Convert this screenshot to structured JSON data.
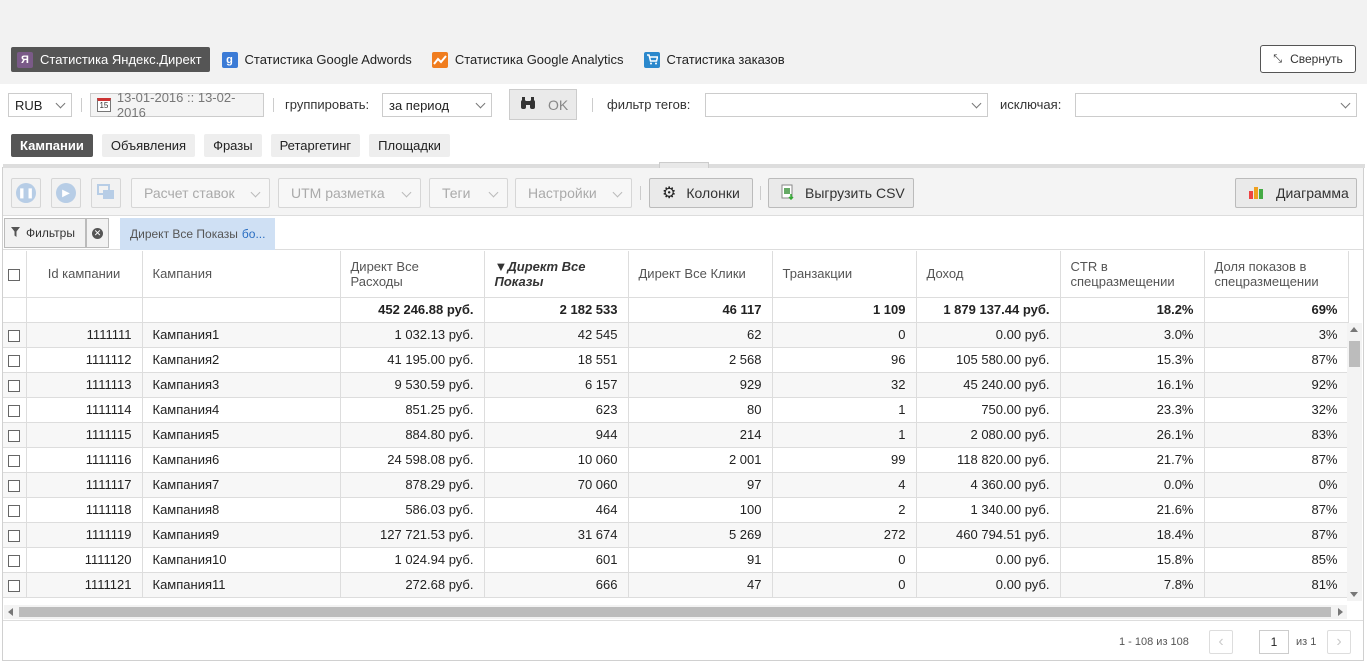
{
  "sources": [
    {
      "label": "Статистика Яндекс.Директ",
      "icon": "yandex-icon",
      "active": true
    },
    {
      "label": "Статистика Google Adwords",
      "icon": "google-adwords-icon",
      "active": false
    },
    {
      "label": "Статистика Google Analytics",
      "icon": "google-analytics-icon",
      "active": false
    },
    {
      "label": "Статистика заказов",
      "icon": "cart-icon",
      "active": false
    }
  ],
  "collapse_label": "Свернуть",
  "filters": {
    "currency": "RUB",
    "date_range": "13-01-2016 :: 13-02-2016",
    "group_label": "группировать:",
    "group_value": "за период",
    "ok_label": "OK",
    "tag_filter_label": "фильтр тегов:",
    "tag_filter_value": "",
    "exclude_label": "исключая:",
    "exclude_value": ""
  },
  "view_tabs": [
    {
      "label": "Кампании",
      "active": true
    },
    {
      "label": "Объявления",
      "active": false
    },
    {
      "label": "Фразы",
      "active": false
    },
    {
      "label": "Ретаргетинг",
      "active": false
    },
    {
      "label": "Площадки",
      "active": false
    }
  ],
  "toolbar": {
    "bid_calc": "Расчет ставок",
    "utm": "UTM разметка",
    "tags": "Теги",
    "settings": "Настройки",
    "columns": "Колонки",
    "export_csv": "Выгрузить CSV",
    "chart": "Диаграмма"
  },
  "filter_row": {
    "filters_label": "Фильтры",
    "chip_text": "Директ Все Показы",
    "chip_more": "бо..."
  },
  "table": {
    "headers": [
      "Id кампании",
      "Кампания",
      "Директ Все Расходы",
      "Директ Все Показы",
      "Директ Все Клики",
      "Транзакции",
      "Доход",
      "CTR в спецразмещении",
      "Доля показов в спецразмещении"
    ],
    "totals": [
      "",
      "",
      "452 246.88 руб.",
      "2 182 533",
      "46 117",
      "1 109",
      "1 879 137.44 руб.",
      "18.2%",
      "69%"
    ],
    "rows": [
      [
        "1111111",
        "Кампания1",
        "1 032.13 руб.",
        "42 545",
        "62",
        "0",
        "0.00 руб.",
        "3.0%",
        "3%"
      ],
      [
        "1111112",
        "Кампания2",
        "41 195.00 руб.",
        "18 551",
        "2 568",
        "96",
        "105 580.00 руб.",
        "15.3%",
        "87%"
      ],
      [
        "1111113",
        "Кампания3",
        "9 530.59 руб.",
        "6 157",
        "929",
        "32",
        "45 240.00 руб.",
        "16.1%",
        "92%"
      ],
      [
        "1111114",
        "Кампания4",
        "851.25 руб.",
        "623",
        "80",
        "1",
        "750.00 руб.",
        "23.3%",
        "32%"
      ],
      [
        "1111115",
        "Кампания5",
        "884.80 руб.",
        "944",
        "214",
        "1",
        "2 080.00 руб.",
        "26.1%",
        "83%"
      ],
      [
        "1111116",
        "Кампания6",
        "24 598.08 руб.",
        "10 060",
        "2 001",
        "99",
        "118 820.00 руб.",
        "21.7%",
        "87%"
      ],
      [
        "1111117",
        "Кампания7",
        "878.29 руб.",
        "70 060",
        "97",
        "4",
        "4 360.00 руб.",
        "0.0%",
        "0%"
      ],
      [
        "1111118",
        "Кампания8",
        "586.03 руб.",
        "464",
        "100",
        "2",
        "1 340.00 руб.",
        "21.6%",
        "87%"
      ],
      [
        "1111119",
        "Кампания9",
        "127 721.53 руб.",
        "31 674",
        "5 269",
        "272",
        "460 794.51 руб.",
        "18.4%",
        "87%"
      ],
      [
        "1111120",
        "Кампания10",
        "1 024.94 руб.",
        "601",
        "91",
        "0",
        "0.00 руб.",
        "15.8%",
        "85%"
      ],
      [
        "1111121",
        "Кампания11",
        "272.68 руб.",
        "666",
        "47",
        "0",
        "0.00 руб.",
        "7.8%",
        "81%"
      ]
    ]
  },
  "pager": {
    "info": "1 - 108 из 108",
    "page": "1",
    "of": "из 1"
  }
}
